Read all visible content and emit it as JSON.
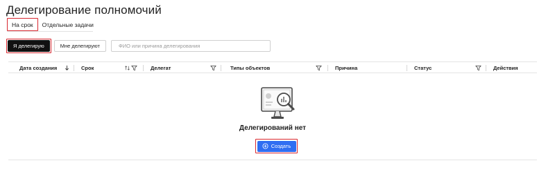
{
  "page": {
    "title": "Делегирование полномочий"
  },
  "tabs": [
    {
      "label": "На срок",
      "active": true
    },
    {
      "label": "Отдельные задачи",
      "active": false
    }
  ],
  "toggle": {
    "my_delegations": "Я делегирую",
    "delegated_to_me": "Мне делегируют"
  },
  "search": {
    "placeholder": "ФИО или причина делегирования"
  },
  "table": {
    "columns": [
      {
        "label": "Дата создания",
        "icon": "arrow-down-sort-icon"
      },
      {
        "label": "Срок",
        "icon": "sort-filter-icons"
      },
      {
        "label": "Делегат",
        "icon": "filter-icon"
      },
      {
        "label": "Типы объектов",
        "icon": "filter-icon"
      },
      {
        "label": "Причина",
        "icon": ""
      },
      {
        "label": "Статус",
        "icon": "filter-icon"
      },
      {
        "label": "Действия",
        "icon": ""
      }
    ]
  },
  "empty": {
    "message": "Делегирований нет",
    "create_label": "Создать",
    "illustration": "monitor-search-icon"
  },
  "colors": {
    "accent": "#2f6ef2",
    "highlight_border": "#d7262e",
    "active_toggle": "#111111"
  }
}
